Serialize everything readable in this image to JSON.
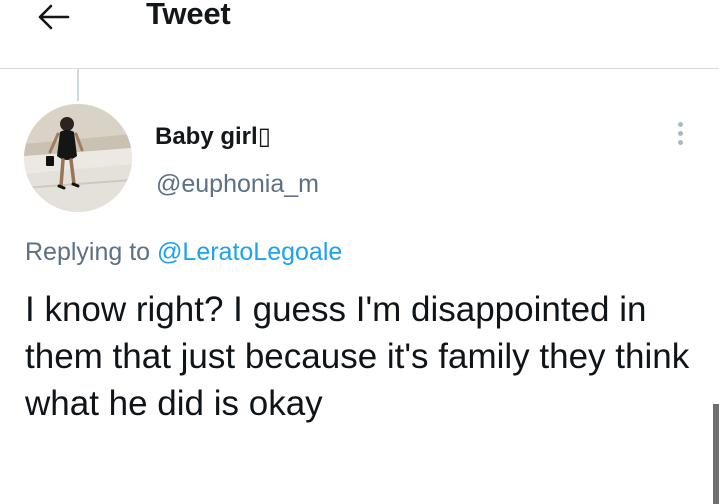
{
  "header": {
    "title": "Tweet",
    "back_icon": "arrow-left-icon"
  },
  "tweet": {
    "author": {
      "name": "Baby girl▯",
      "handle": "@euphonia_m"
    },
    "replying_to": {
      "prefix": "Replying to",
      "handle": "@LeratoLegoale"
    },
    "text": "I know right? I guess I'm disappointed in them that just because it's family they think what he did is okay",
    "more_icon": "more-vertical-icon"
  },
  "colors": {
    "link": "#1da1f2",
    "secondary_text": "#5b7083",
    "primary_text": "#0f1419",
    "divider": "#d9d9d9"
  }
}
